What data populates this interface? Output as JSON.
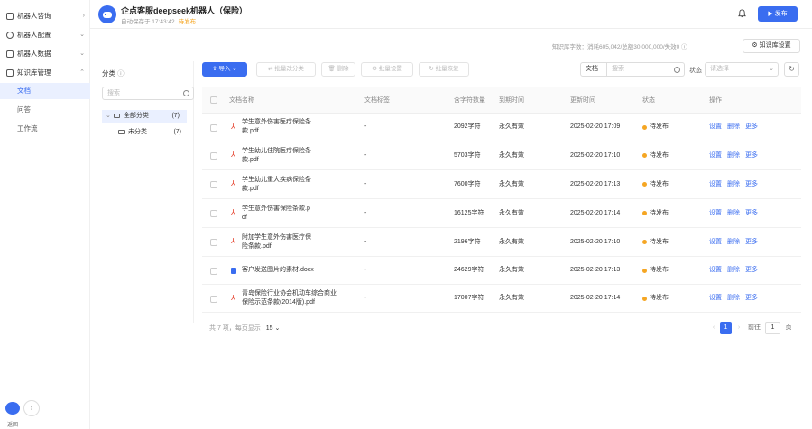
{
  "header": {
    "bot_name": "企点客服deepseek机器人（保险）",
    "save_info": "自动保存于 17:43:42",
    "status": "待发布",
    "publish_label": "发布"
  },
  "sidebar": {
    "items": [
      {
        "label": "机器人咨询"
      },
      {
        "label": "机器人配置"
      },
      {
        "label": "机器人数据"
      },
      {
        "label": "知识库管理"
      }
    ],
    "sub_items": [
      {
        "label": "文档"
      },
      {
        "label": "问答"
      },
      {
        "label": "工作流"
      }
    ],
    "bottom_label": "返回"
  },
  "stats": {
    "text": "知识库字数：消耗605,042/总额30,000,000/失效0",
    "kb_settings_label": "知识库设置"
  },
  "categories": {
    "title": "分类",
    "search_placeholder": "搜索",
    "nodes": [
      {
        "label": "全部分类",
        "count": "(7)"
      },
      {
        "label": "未分类",
        "count": "(7)"
      }
    ]
  },
  "toolbar": {
    "import": "导入",
    "batch_category": "批量改分类",
    "delete": "删除",
    "batch_settings": "批量设置",
    "batch_restore": "批量恢复"
  },
  "filters": {
    "type": "文档",
    "search_placeholder": "搜索",
    "status_label": "状态",
    "status_placeholder": "请选择"
  },
  "table": {
    "headers": [
      "文档名称",
      "文档标签",
      "含字符数量",
      "到期时间",
      "更新时间",
      "状态",
      "操作"
    ],
    "rows": [
      {
        "icon": "pdf",
        "name_a": "学生意外伤害医疗保险条",
        "name_b": "款.pdf",
        "tag": "-",
        "chars": "2092字符",
        "expire": "永久有效",
        "updated": "2025-02-20 17:09",
        "status": "待发布"
      },
      {
        "icon": "pdf",
        "name_a": "学生幼儿住院医疗保险条",
        "name_b": "款.pdf",
        "tag": "-",
        "chars": "5703字符",
        "expire": "永久有效",
        "updated": "2025-02-20 17:10",
        "status": "待发布"
      },
      {
        "icon": "pdf",
        "name_a": "学生幼儿重大疾病保险条",
        "name_b": "款.pdf",
        "tag": "-",
        "chars": "7600字符",
        "expire": "永久有效",
        "updated": "2025-02-20 17:13",
        "status": "待发布"
      },
      {
        "icon": "pdf",
        "name_a": "学生意外伤害保险条款.p",
        "name_b": "df",
        "tag": "-",
        "chars": "16125字符",
        "expire": "永久有效",
        "updated": "2025-02-20 17:14",
        "status": "待发布"
      },
      {
        "icon": "pdf",
        "name_a": "附加学生意外伤害医疗保",
        "name_b": "险条款.pdf",
        "tag": "-",
        "chars": "2196字符",
        "expire": "永久有效",
        "updated": "2025-02-20 17:10",
        "status": "待发布"
      },
      {
        "icon": "doc",
        "name_a": "客户发送图片的素材.docx",
        "name_b": "",
        "tag": "-",
        "chars": "24629字符",
        "expire": "永久有效",
        "updated": "2025-02-20 17:13",
        "status": "待发布"
      },
      {
        "icon": "pdf",
        "name_a": "青岛保险行业协会机动车综合商业",
        "name_b": "保险示范条款(2014版).pdf",
        "tag": "-",
        "chars": "17007字符",
        "expire": "永久有效",
        "updated": "2025-02-20 17:14",
        "status": "待发布"
      }
    ],
    "ops": [
      "设置",
      "删除",
      "更多"
    ]
  },
  "footer": {
    "total": "共 7 项，每页显示",
    "page_size": "15",
    "current_page": "1",
    "goto_label": "前往",
    "goto_value": "1",
    "page_unit": "页"
  },
  "colors": {
    "accent": "#3a6df0",
    "pending": "#f5a623",
    "pdf": "#e5412d"
  }
}
